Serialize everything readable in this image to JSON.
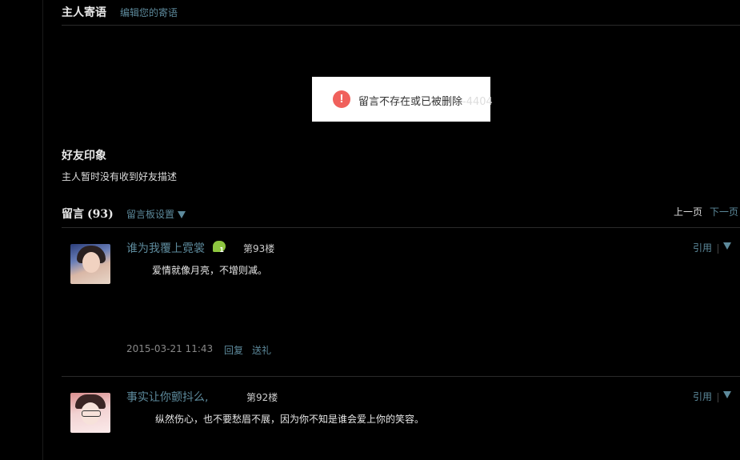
{
  "owner_message": {
    "title": "主人寄语",
    "edit_link": "编辑您的寄语"
  },
  "toast": {
    "icon": "exclamation-icon",
    "icon_glyph": "!",
    "text": "留言不存在或已被删除",
    "code": "-4404",
    "icon_color": "#f0615c"
  },
  "friend_impression": {
    "title": "好友印象",
    "description": "主人暂时没有收到好友描述"
  },
  "messages": {
    "title": "留言",
    "count": "(93)",
    "board_settings": "留言板设置",
    "prev_page": "上一页",
    "next_page": "下一页",
    "items": [
      {
        "author": "谁为我覆上霓裳",
        "badge": "1",
        "floor": "第93楼",
        "content": "爱情就像月亮，不增则减。",
        "date": "2015-03-21 11:43",
        "reply": "回复",
        "gift": "送礼",
        "quote": "引用"
      },
      {
        "author": "事实让你颤抖么,",
        "floor": "第92楼",
        "content": "纵然伤心，也不要愁眉不展，因为你不知是谁会爱上你的笑容。",
        "quote": "引用"
      }
    ]
  },
  "colors": {
    "background": "#000000",
    "link": "#5d8a9c",
    "divider": "#2a2a2a"
  }
}
